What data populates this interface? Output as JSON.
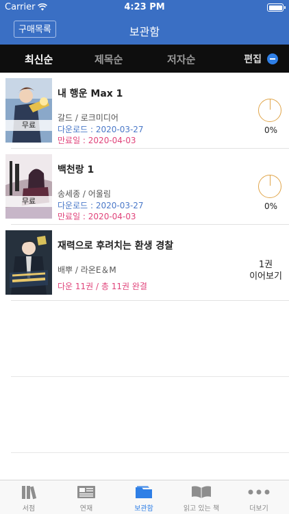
{
  "status": {
    "carrier": "Carrier",
    "time": "4:23 PM"
  },
  "nav": {
    "purchase_label": "구매목록",
    "title": "보관함"
  },
  "sort": {
    "tabs": [
      "최신순",
      "제목순",
      "저자순"
    ],
    "edit_label": "편집"
  },
  "books": [
    {
      "title": "내 행운 Max 1",
      "author": "갈드 / 로크미디어",
      "download": "다운로드 : 2020-03-27",
      "expire": "만료일 : 2020-04-03",
      "badge": "무료",
      "progress": "0%"
    },
    {
      "title": "백천랑 1",
      "author": "송세종 / 어울림",
      "download": "다운로드 : 2020-03-27",
      "expire": "만료일 : 2020-04-03",
      "badge": "무료",
      "progress": "0%"
    },
    {
      "title": "재력으로 후려치는 환생 경찰",
      "author": "배뿌 / 라온E＆M",
      "count": "다운 11권 / 총 11권 완결",
      "continue_line1": "1권",
      "continue_line2": "이어보기"
    }
  ],
  "tabbar": [
    {
      "label": "서점",
      "icon": "books-icon"
    },
    {
      "label": "연재",
      "icon": "newspaper-icon"
    },
    {
      "label": "보관함",
      "icon": "folder-icon",
      "active": true
    },
    {
      "label": "읽고 있는 책",
      "icon": "open-book-icon"
    },
    {
      "label": "더보기",
      "icon": "more-dots-icon"
    }
  ],
  "colors": {
    "primary": "#3a6fc4",
    "accent": "#2f7fe6",
    "expire": "#e0437a",
    "download": "#4a78c8",
    "progress": "#e0a448"
  }
}
